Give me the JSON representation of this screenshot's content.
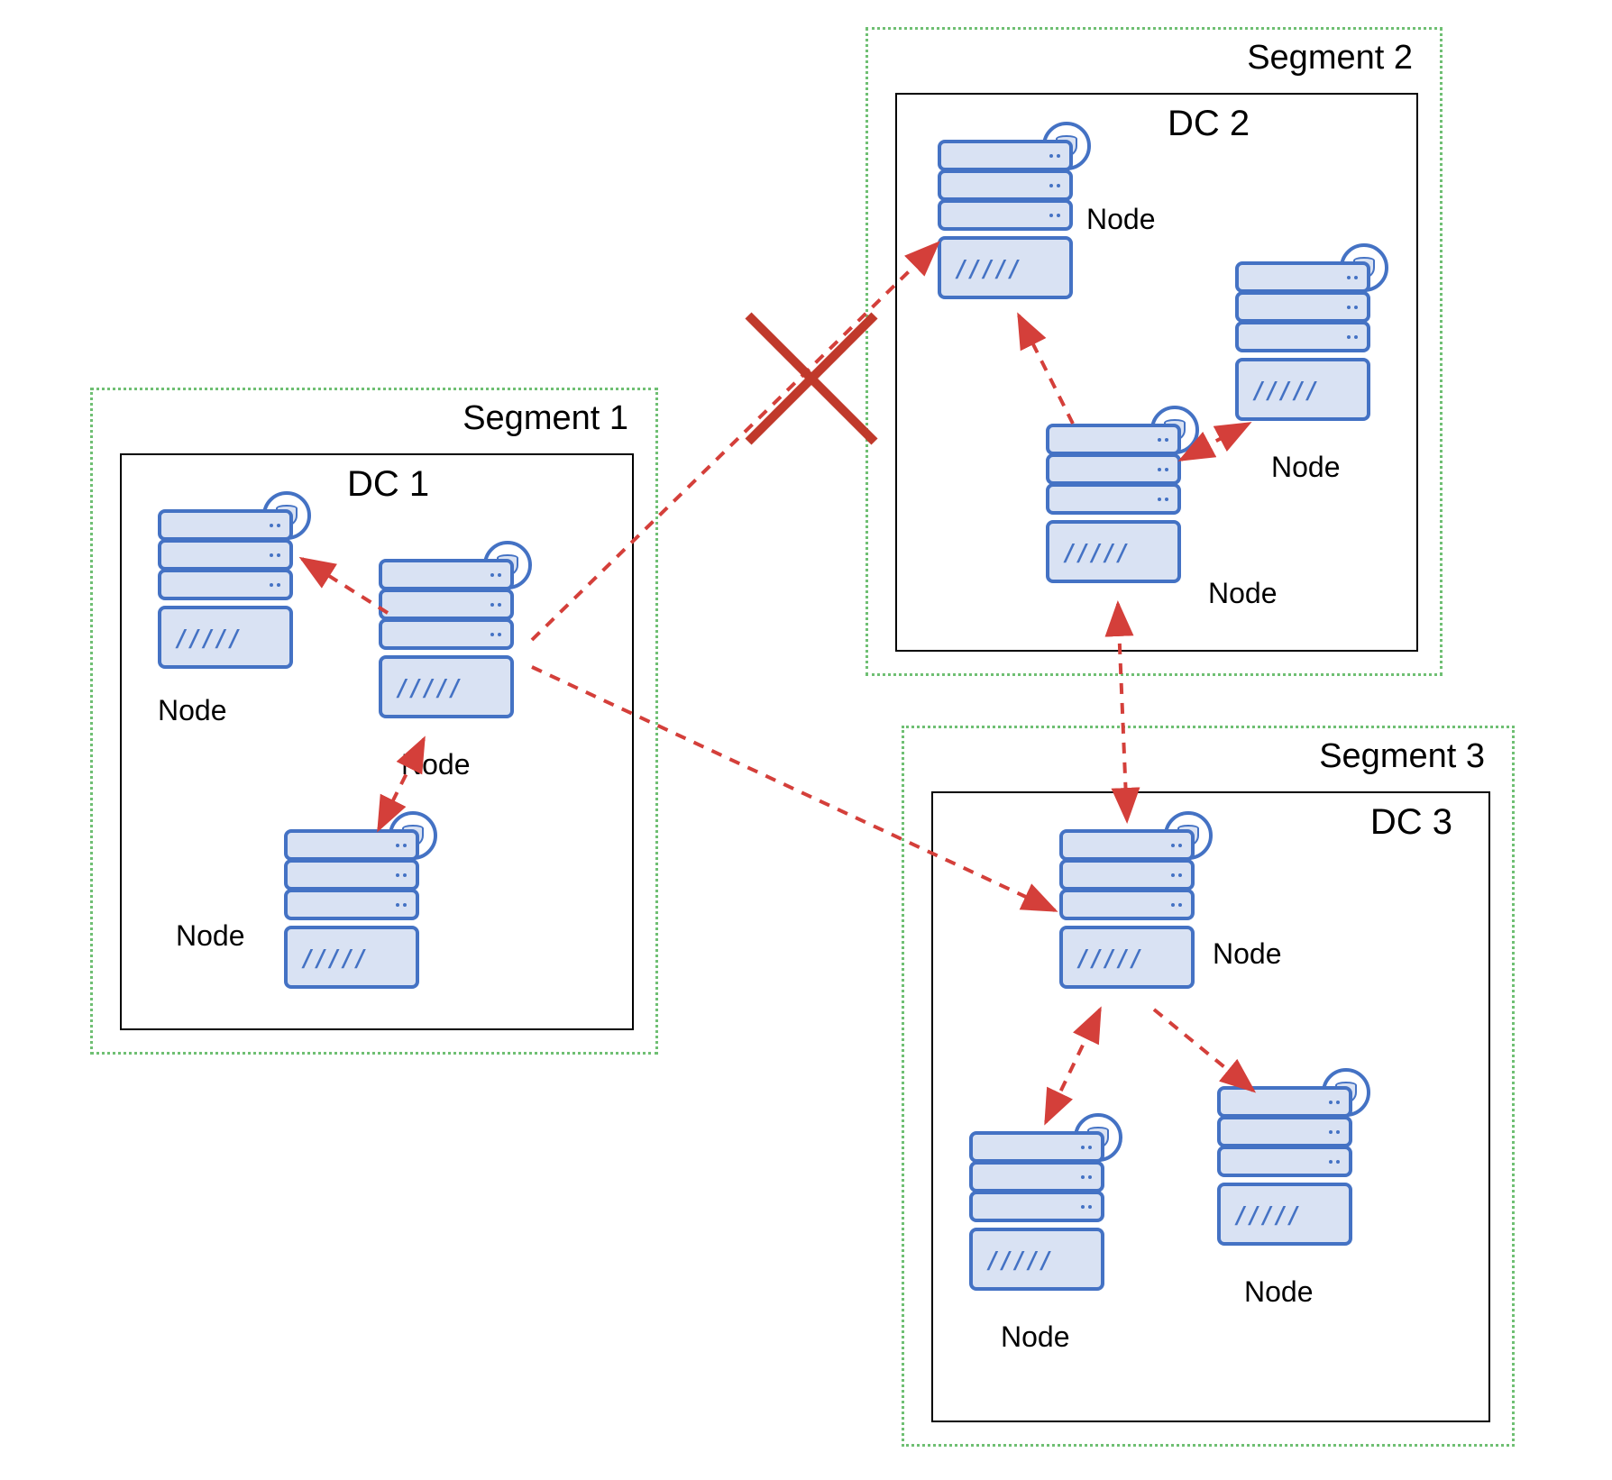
{
  "segments": {
    "s1": {
      "label": "Segment 1",
      "dc_label": "DC 1"
    },
    "s2": {
      "label": "Segment 2",
      "dc_label": "DC 2"
    },
    "s3": {
      "label": "Segment 3",
      "dc_label": "DC 3"
    }
  },
  "node_label": "Node",
  "colors": {
    "segment_border": "#6fbf73",
    "dc_border": "#000000",
    "server_fill": "#d9e2f3",
    "server_border": "#4472c4",
    "arrow": "#d43f3a",
    "cross": "#c0392b"
  }
}
